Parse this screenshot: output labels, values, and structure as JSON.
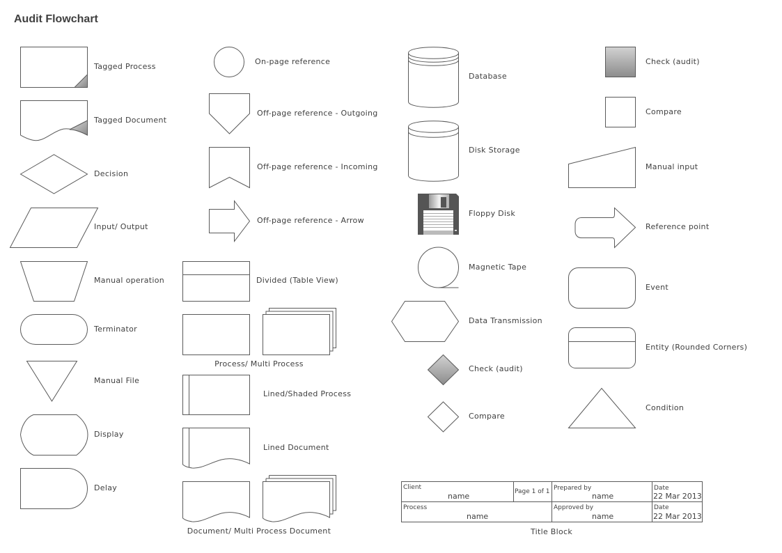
{
  "page": {
    "title": "Audit Flowchart"
  },
  "shapes": {
    "col1": {
      "tagged_process": "Tagged Process",
      "tagged_document": "Tagged Document",
      "decision": "Decision",
      "input_output": "Input/ Output",
      "manual_operation": "Manual operation",
      "terminator": "Terminator",
      "manual_file": "Manual File",
      "display": "Display",
      "delay": "Delay"
    },
    "col2": {
      "on_page_reference": "On-page reference",
      "off_page_outgoing": "Off-page reference - Outgoing",
      "off_page_incoming": "Off-page reference - Incoming",
      "off_page_arrow": "Off-page reference - Arrow",
      "divided_table_view": "Divided (Table View)",
      "process_multi_process": "Process/ Multi Process",
      "lined_shaded_process": "Lined/Shaded Process",
      "lined_document": "Lined Document",
      "document_multi_document": "Document/ Multi Process Document"
    },
    "col3": {
      "database": "Database",
      "disk_storage": "Disk Storage",
      "floppy_disk": "Floppy Disk",
      "magnetic_tape": "Magnetic Tape",
      "data_transmission": "Data Transmission",
      "check_audit": "Check (audit)",
      "compare": "Compare"
    },
    "col4": {
      "check_audit": "Check (audit)",
      "compare": "Compare",
      "manual_input": "Manual input",
      "reference_point": "Reference point",
      "event": "Event",
      "entity_rounded": "Entity (Rounded Corners)",
      "condition": "Condition"
    }
  },
  "title_block": {
    "caption": "Title Block",
    "client_label": "Client",
    "client_value": "name",
    "page_text": "Page 1 of 1",
    "prepared_by_label": "Prepared by",
    "prepared_by_value": "name",
    "date1_label": "Date",
    "date1_value": "22 Mar 2013",
    "process_label": "Process",
    "process_value": "name",
    "approved_by_label": "Approved by",
    "approved_by_value": "name",
    "date2_label": "Date",
    "date2_value": "22 Mar 2013"
  },
  "colors": {
    "stroke": "#5a5a5a",
    "shade_light": "#d0d0d0",
    "shade_dark": "#8a8a8a",
    "floppy": "#555555",
    "text": "#404040"
  }
}
